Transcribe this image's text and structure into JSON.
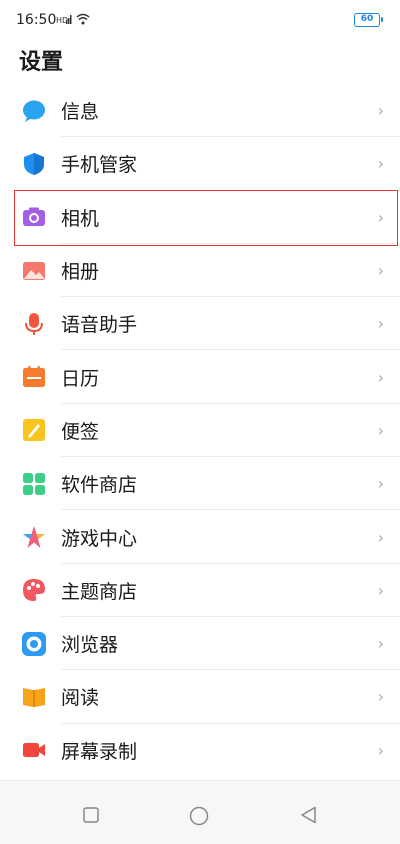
{
  "status_bar": {
    "time": "16:50",
    "battery": "60",
    "icons": [
      "sim-signal-icon",
      "wifi-icon"
    ]
  },
  "page": {
    "title": "设置"
  },
  "settings_items": [
    {
      "label": "信息",
      "icon": "message-icon"
    },
    {
      "label": "手机管家",
      "icon": "shield-icon"
    },
    {
      "label": "相机",
      "icon": "camera-icon"
    },
    {
      "label": "相册",
      "icon": "gallery-icon"
    },
    {
      "label": "语音助手",
      "icon": "microphone-icon"
    },
    {
      "label": "日历",
      "icon": "calendar-icon"
    },
    {
      "label": "便签",
      "icon": "notes-icon"
    },
    {
      "label": "软件商店",
      "icon": "app-store-icon"
    },
    {
      "label": "游戏中心",
      "icon": "game-center-icon"
    },
    {
      "label": "主题商店",
      "icon": "theme-palette-icon"
    },
    {
      "label": "浏览器",
      "icon": "browser-icon"
    },
    {
      "label": "阅读",
      "icon": "reading-book-icon"
    },
    {
      "label": "屏幕录制",
      "icon": "screen-record-icon"
    }
  ],
  "chevron": "›",
  "highlighted_item": "相机",
  "nav_bar": {
    "icons": [
      "recents-square-icon",
      "home-circle-icon",
      "back-triangle-icon"
    ]
  }
}
